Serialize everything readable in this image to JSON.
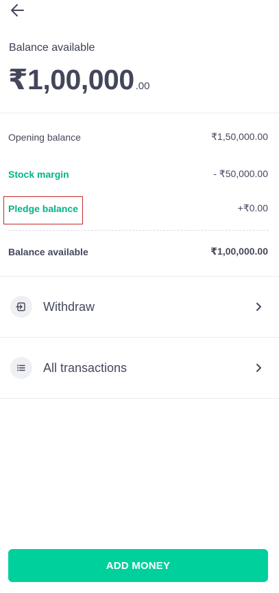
{
  "header": {
    "back_icon": "arrow-left-icon"
  },
  "balance": {
    "label": "Balance available",
    "amount_main": "₹1,00,000",
    "amount_decimal": ".00"
  },
  "breakdown": {
    "opening": {
      "label": "Opening balance",
      "value": "₹1,50,000.00"
    },
    "stock_margin": {
      "label": "Stock margin",
      "value": "- ₹50,000.00"
    },
    "pledge": {
      "label": "Pledge balance",
      "value": "+₹0.00"
    },
    "available": {
      "label": "Balance available",
      "value": "₹1,00,000.00"
    }
  },
  "menu": {
    "withdraw": {
      "label": "Withdraw",
      "icon": "withdraw-icon"
    },
    "transactions": {
      "label": "All transactions",
      "icon": "list-icon"
    }
  },
  "cta": {
    "label": "ADD MONEY"
  },
  "colors": {
    "accent": "#00d09c",
    "accent_text": "#00b386",
    "text": "#44475b",
    "highlight": "#c62828"
  }
}
